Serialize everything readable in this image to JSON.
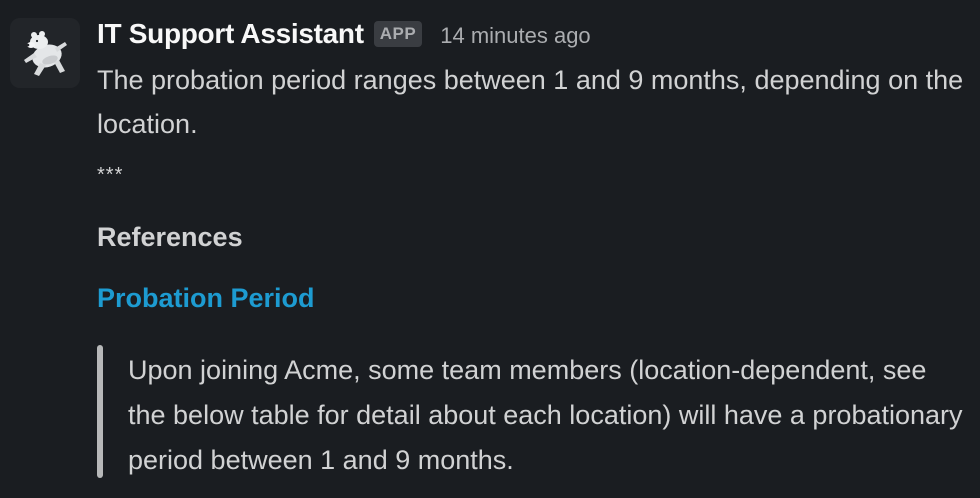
{
  "message": {
    "sender": "IT Support Assistant",
    "badge": "APP",
    "timestamp": "14 minutes ago",
    "avatar_icon": "polar-bear-icon",
    "text": "The probation period ranges between 1 and 9 months, depending on the location.",
    "separator": "***",
    "references_heading": "References",
    "reference_link": "Probation Period",
    "quote": "Upon joining Acme, some team members (location-dependent, see the below table for detail about each location) will have a probationary period between 1 and 9 months."
  },
  "colors": {
    "background": "#1a1d21",
    "link": "#1d9bd1",
    "quote_bar": "#b7b8b9"
  }
}
